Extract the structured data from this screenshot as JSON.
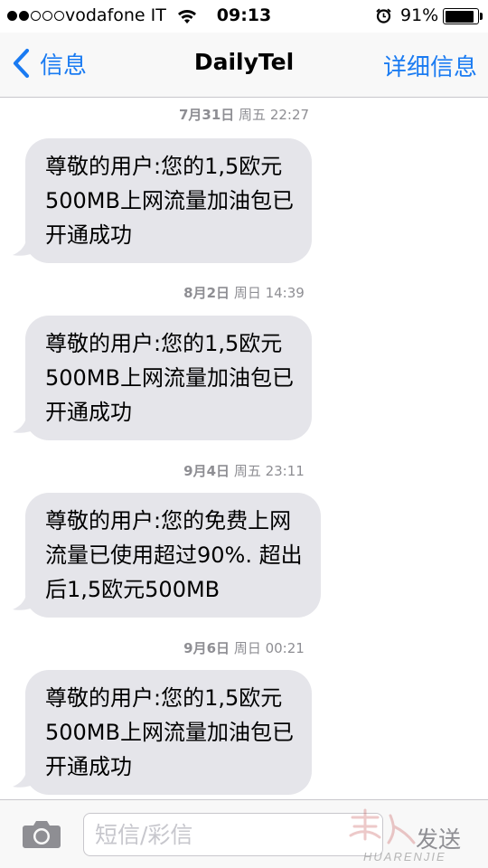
{
  "status_bar": {
    "signal_strength": 2,
    "signal_max": 5,
    "carrier": "vodafone IT",
    "wifi_icon": "wifi-icon",
    "time": "09:13",
    "alarm_icon": "alarm-icon",
    "battery_percent": "91%",
    "battery_level": 0.91
  },
  "nav": {
    "back_label": "信息",
    "title": "DailyTel",
    "details_label": "详细信息"
  },
  "conversation": [
    {
      "timestamp": {
        "date": "7月31日",
        "rest": "周五 22:27"
      },
      "message_lines": [
        "尊敬的用户:您的1,5欧元",
        "500MB上网流量加油包已",
        "开通成功"
      ]
    },
    {
      "timestamp": {
        "date": "8月2日",
        "rest": "周日 14:39"
      },
      "message_lines": [
        "尊敬的用户:您的1,5欧元",
        "500MB上网流量加油包已",
        "开通成功"
      ]
    },
    {
      "timestamp": {
        "date": "9月4日",
        "rest": "周五 23:11"
      },
      "message_lines": [
        "尊敬的用户:您的免费上网",
        "流量已使用超过90%. 超出",
        "后1,5欧元500MB"
      ]
    },
    {
      "timestamp": {
        "date": "9月6日",
        "rest": "周日 00:21"
      },
      "message_lines": [
        "尊敬的用户:您的1,5欧元",
        "500MB上网流量加油包已",
        "开通成功"
      ]
    }
  ],
  "input_bar": {
    "camera_icon": "camera-icon",
    "placeholder": "短信/彩信",
    "send_label": "发送"
  },
  "watermark": {
    "logo": "华人街",
    "text": "HUARENJIE"
  },
  "colors": {
    "accent": "#1a7bf2",
    "bubble": "#e5e5ea",
    "timestamp": "#8e8e93",
    "bar": "#f8f8f8"
  }
}
